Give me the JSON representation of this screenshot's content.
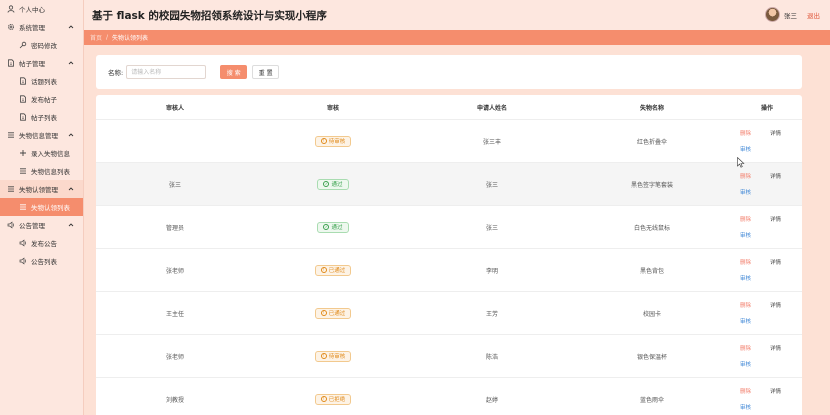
{
  "header": {
    "title": "基于 flask 的校园失物招领系统设计与实现小程序",
    "user_name": "张三",
    "logout": "退出"
  },
  "breadcrumb": {
    "home": "首页",
    "sep": "/",
    "current": "失物认领列表"
  },
  "sidebar": {
    "items": [
      {
        "label": "个人中心",
        "icon": "person-icon",
        "level": 0,
        "arrow": false
      },
      {
        "label": "系统管理",
        "icon": "gear-icon",
        "level": 0,
        "arrow": true
      },
      {
        "label": "密码修改",
        "icon": "key-icon",
        "level": 1,
        "arrow": false
      },
      {
        "label": "帖子管理",
        "icon": "document-icon",
        "level": 0,
        "arrow": true
      },
      {
        "label": "话题列表",
        "icon": "document-icon",
        "level": 1,
        "arrow": false
      },
      {
        "label": "发布帖子",
        "icon": "document-icon",
        "level": 1,
        "arrow": false
      },
      {
        "label": "帖子列表",
        "icon": "document-icon",
        "level": 1,
        "arrow": false
      },
      {
        "label": "失物信息管理",
        "icon": "list-icon",
        "level": 0,
        "arrow": true
      },
      {
        "label": "录入失物信息",
        "icon": "plus-icon",
        "level": 1,
        "arrow": false
      },
      {
        "label": "失物信息列表",
        "icon": "list-icon",
        "level": 1,
        "arrow": false
      },
      {
        "label": "失物认领管理",
        "icon": "list-icon",
        "level": 0,
        "arrow": true,
        "open": true
      },
      {
        "label": "失物认领列表",
        "icon": "list-icon",
        "level": 1,
        "arrow": false,
        "active": true
      },
      {
        "label": "公告管理",
        "icon": "speaker-icon",
        "level": 0,
        "arrow": true
      },
      {
        "label": "发布公告",
        "icon": "speaker-icon",
        "level": 1,
        "arrow": false
      },
      {
        "label": "公告列表",
        "icon": "speaker-icon",
        "level": 1,
        "arrow": false
      }
    ]
  },
  "search": {
    "label": "名称:",
    "placeholder": "请输入名称",
    "search_btn": "搜 索",
    "reset_btn": "重 置"
  },
  "table": {
    "columns": [
      "审核人",
      "审核",
      "申请人姓名",
      "失物名称",
      "操作"
    ],
    "ops": {
      "delete": "删除",
      "detail": "详情",
      "audit": "审核"
    },
    "rows": [
      {
        "reviewer": "",
        "status": "待审核",
        "status_type": "pending",
        "applicant": "张三丰",
        "item": "红色折叠伞"
      },
      {
        "reviewer": "张三",
        "status": "通过",
        "status_type": "passed",
        "applicant": "张三",
        "item": "黑色签字笔套装"
      },
      {
        "reviewer": "管理员",
        "status": "通过",
        "status_type": "passed",
        "applicant": "张三",
        "item": "白色无线鼠标"
      },
      {
        "reviewer": "张老师",
        "status": "已通过",
        "status_type": "pending",
        "applicant": "李明",
        "item": "黑色背包"
      },
      {
        "reviewer": "王主任",
        "status": "已通过",
        "status_type": "pending",
        "applicant": "王芳",
        "item": "校园卡"
      },
      {
        "reviewer": "张老师",
        "status": "待审核",
        "status_type": "pending",
        "applicant": "陈浩",
        "item": "银色保温杯"
      },
      {
        "reviewer": "刘教授",
        "status": "已拒绝",
        "status_type": "rejected",
        "applicant": "赵婷",
        "item": "蓝色雨伞"
      }
    ]
  }
}
